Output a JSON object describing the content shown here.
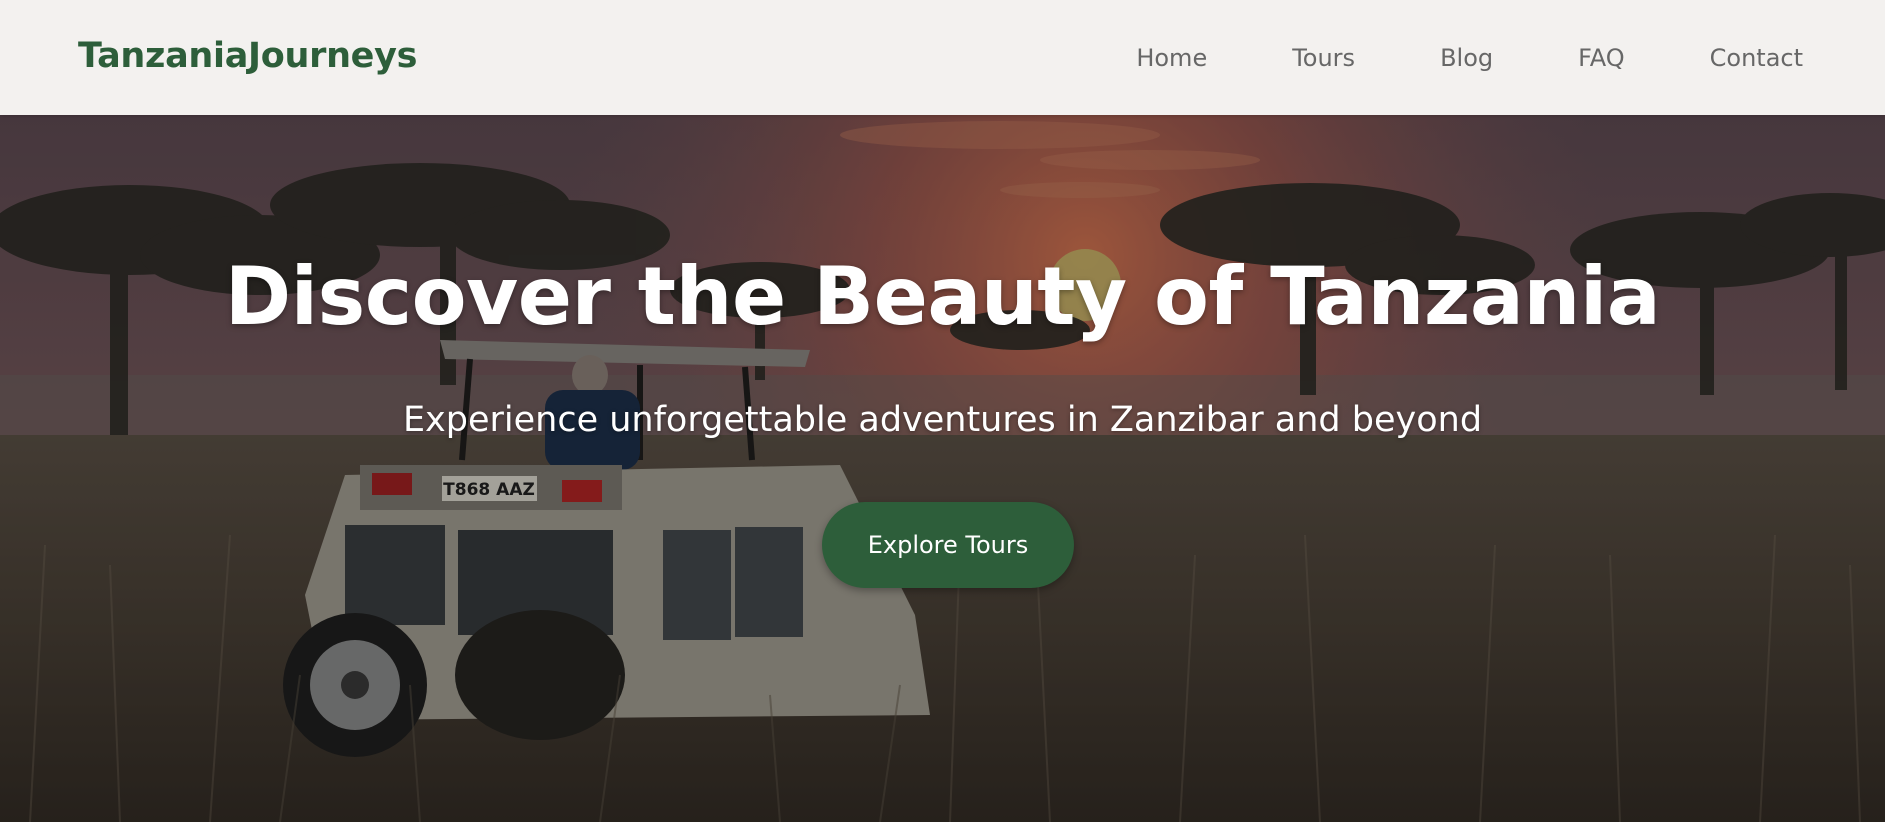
{
  "header": {
    "logo": "TanzaniaJourneys",
    "nav": [
      {
        "label": "Home"
      },
      {
        "label": "Tours"
      },
      {
        "label": "Blog"
      },
      {
        "label": "FAQ"
      },
      {
        "label": "Contact"
      }
    ]
  },
  "hero": {
    "title": "Discover the Beauty of Tanzania",
    "subtitle": "Experience unforgettable adventures in Zanzibar and beyond",
    "cta_label": "Explore Tours",
    "vehicle_plate": "T868 AAZ"
  },
  "colors": {
    "brand_green": "#2d5e3a",
    "header_bg": "#f3f1ef",
    "nav_text": "#676767"
  }
}
